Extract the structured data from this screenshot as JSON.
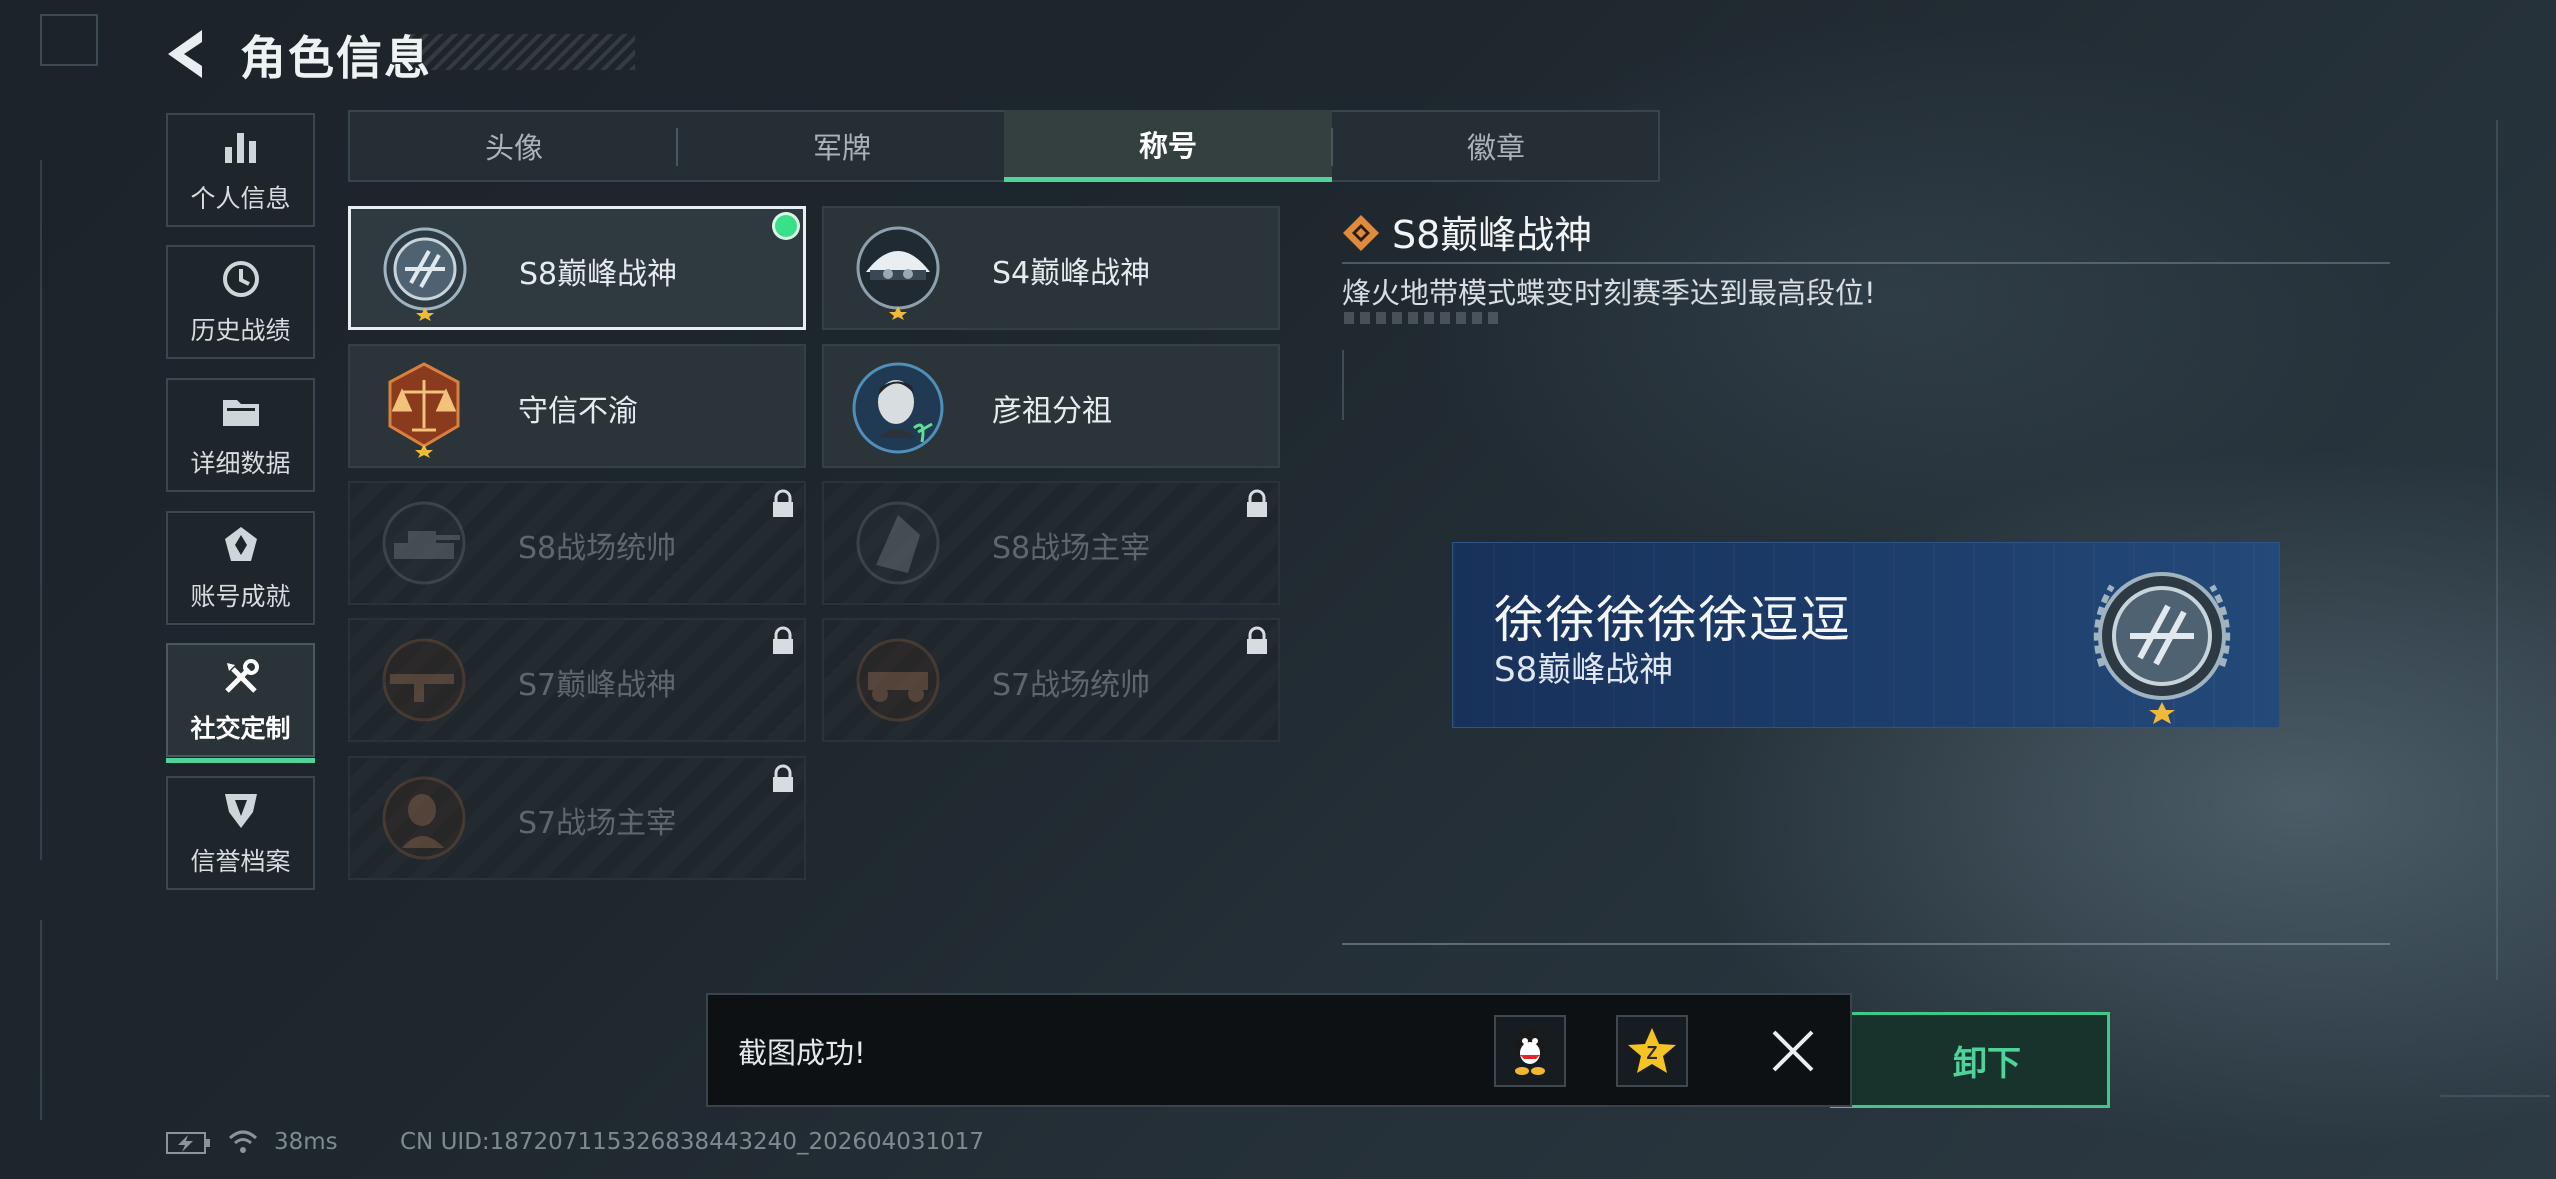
{
  "header": {
    "title": "角色信息"
  },
  "sidebar": {
    "items": [
      {
        "label": "个人信息",
        "icon": "bar-chart-icon"
      },
      {
        "label": "历史战绩",
        "icon": "clock-icon"
      },
      {
        "label": "详细数据",
        "icon": "folder-icon"
      },
      {
        "label": "账号成就",
        "icon": "achievement-icon"
      },
      {
        "label": "社交定制",
        "icon": "tools-icon",
        "active": true
      },
      {
        "label": "信誉档案",
        "icon": "credit-shield-icon"
      }
    ]
  },
  "tabs": [
    {
      "label": "头像"
    },
    {
      "label": "军牌"
    },
    {
      "label": "称号",
      "active": true
    },
    {
      "label": "徽章"
    }
  ],
  "titles": [
    {
      "name": "S8巅峰战神",
      "locked": false,
      "equipped": true,
      "selected": true
    },
    {
      "name": "S4巅峰战神",
      "locked": false
    },
    {
      "name": "守信不渝",
      "locked": false
    },
    {
      "name": "彦祖分祖",
      "locked": false
    },
    {
      "name": "S8战场统帅",
      "locked": true
    },
    {
      "name": "S8战场主宰",
      "locked": true
    },
    {
      "name": "S7巅峰战神",
      "locked": true
    },
    {
      "name": "S7战场统帅",
      "locked": true
    },
    {
      "name": "S7战场主宰",
      "locked": true
    }
  ],
  "detail": {
    "title": "S8巅峰战神",
    "description": "烽火地带模式蝶变时刻赛季达到最高段位!"
  },
  "preview": {
    "player_name": "徐徐徐徐徐逗逗",
    "title": "S8巅峰战神"
  },
  "unequip_button": {
    "label_visible": "卸下"
  },
  "toast": {
    "message": "截图成功!",
    "share_icons": [
      "qq-icon",
      "qzone-star-icon"
    ],
    "close_icon": "close-icon"
  },
  "status": {
    "ping": "38ms",
    "uid": "CN UID:18720711532683844324​0_202604031017"
  },
  "colors": {
    "accent": "#4fd39b",
    "equipped_dot": "#3ae089",
    "banner_blue": "#1d3d6b",
    "title_diamond": "#e08a3c"
  }
}
